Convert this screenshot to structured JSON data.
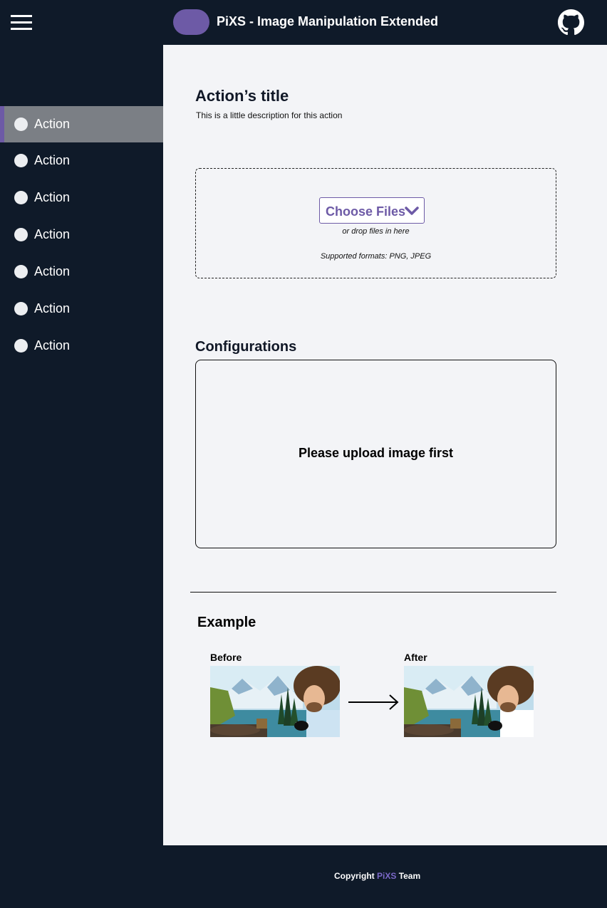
{
  "header": {
    "title": "PiXS - Image Manipulation Extended",
    "menu_icon": "hamburger-icon",
    "repo_icon": "github-icon"
  },
  "sidebar": {
    "items": [
      {
        "label": "Action",
        "active": true
      },
      {
        "label": "Action",
        "active": false
      },
      {
        "label": "Action",
        "active": false
      },
      {
        "label": "Action",
        "active": false
      },
      {
        "label": "Action",
        "active": false
      },
      {
        "label": "Action",
        "active": false
      },
      {
        "label": "Action",
        "active": false
      }
    ]
  },
  "main": {
    "title": "Action’s title",
    "description": "This is a little description for this action",
    "upload": {
      "button_label": "Choose Files",
      "drop_hint": "or drop files in here",
      "formats": "Supported formats: PNG, JPEG"
    },
    "config": {
      "heading": "Configurations",
      "placeholder": "Please upload image first"
    },
    "example": {
      "heading": "Example",
      "before_label": "Before",
      "after_label": "After"
    }
  },
  "footer": {
    "prefix": "Copyright ",
    "brand": "PiXS",
    "suffix": " Team"
  },
  "colors": {
    "dark": "#0f1a29",
    "accent": "#6d5aa6",
    "content_bg": "#f3f4f7",
    "active_item": "#7b7f85"
  }
}
